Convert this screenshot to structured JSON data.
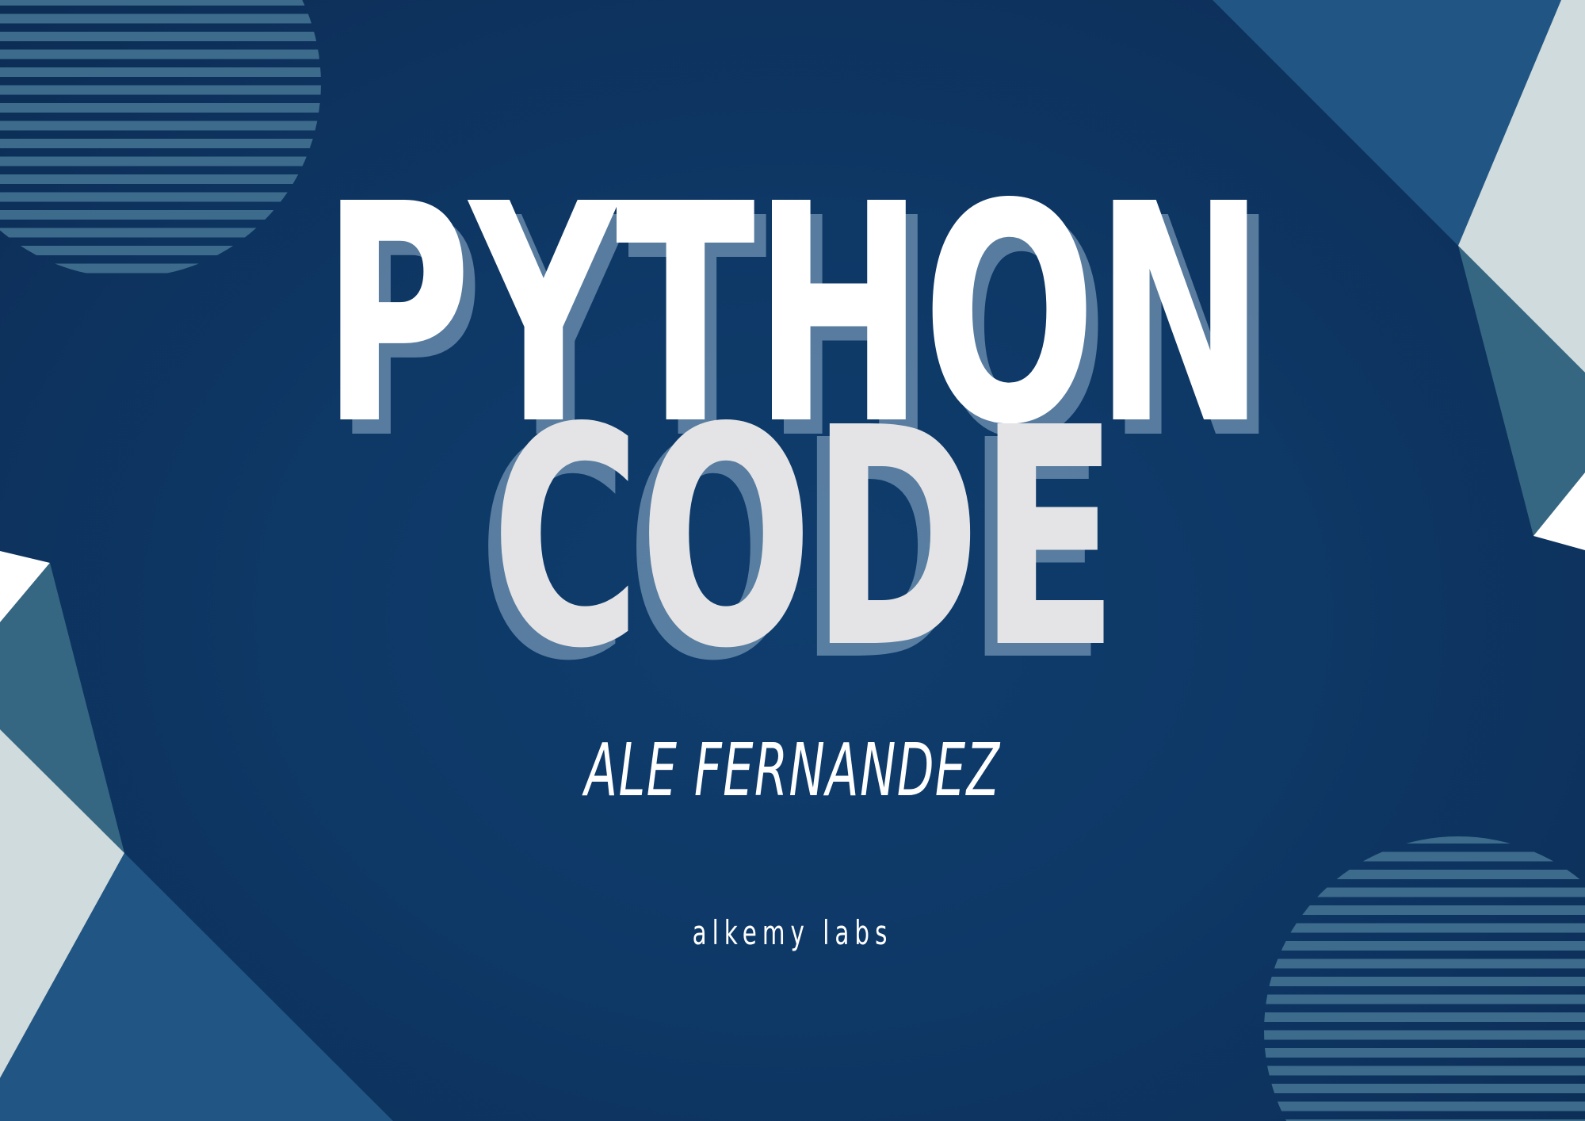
{
  "cover": {
    "title_line1": "PYTHON",
    "title_line2": "CODE",
    "author": "ALE FERNANDEZ",
    "publisher": "alkemy labs"
  },
  "colors": {
    "background": "#0e3866",
    "title_primary": "#ffffff",
    "title_secondary": "#e4e4e6",
    "title_shadow": "#7c97b3",
    "accent_blue": "#215583",
    "accent_teal": "#366782",
    "accent_light": "#cfdbdc",
    "stripe": "#3d6b8c"
  },
  "decorations": [
    "striped-circle-top-left",
    "striped-circle-bottom-right",
    "geometric-shards-top-right",
    "geometric-shards-bottom-left"
  ]
}
